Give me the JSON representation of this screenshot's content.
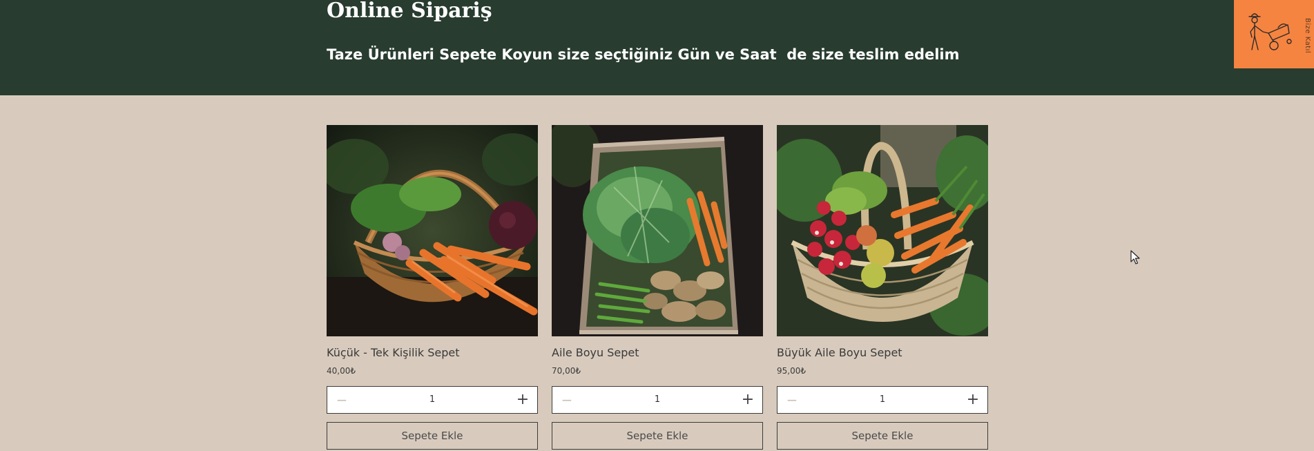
{
  "header": {
    "title": "Online Sipariş",
    "subtitle": "Taze Ürünleri Sepete Koyun size seçtiğiniz Gün ve Saat  de size teslim edelim",
    "badge_text": "Bize Katıl",
    "badge_icon": "farmer-wheelbarrow-icon"
  },
  "colors": {
    "header_bg": "#283c30",
    "page_bg": "#d8cbbd",
    "badge_bg": "#f58440"
  },
  "products": [
    {
      "name": "Küçük - Tek Kişilik Sepet",
      "price": "40,00₺",
      "quantity": "1",
      "button_label": "Sepete Ekle",
      "minus_icon": "minus-icon",
      "plus_icon": "plus-icon"
    },
    {
      "name": "Aile Boyu Sepet",
      "price": "70,00₺",
      "quantity": "1",
      "button_label": "Sepete Ekle",
      "minus_icon": "minus-icon",
      "plus_icon": "plus-icon"
    },
    {
      "name": "Büyük Aile Boyu Sepet",
      "price": "95,00₺",
      "quantity": "1",
      "button_label": "Sepete Ekle",
      "minus_icon": "minus-icon",
      "plus_icon": "plus-icon"
    }
  ],
  "glyphs": {
    "minus": "−",
    "plus": "+"
  }
}
